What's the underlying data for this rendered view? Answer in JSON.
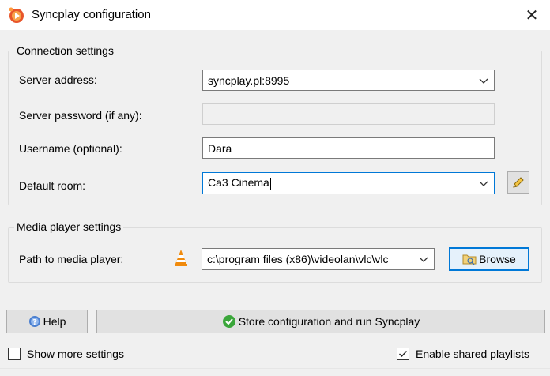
{
  "window": {
    "title": "Syncplay configuration",
    "icon": "syncplay-logo-icon",
    "close_label": "✕"
  },
  "connection": {
    "group_title": "Connection settings",
    "server_address_label": "Server address:",
    "server_address_value": "syncplay.pl:8995",
    "server_password_label": "Server password (if any):",
    "server_password_value": "",
    "username_label": "Username (optional):",
    "username_value": "Dara",
    "default_room_label": "Default room:",
    "default_room_value": "Ca3 Cinema",
    "edit_room_icon": "pencil-icon"
  },
  "media": {
    "group_title": "Media player settings",
    "path_label": "Path to media player:",
    "player_icon": "vlc-icon",
    "path_value": "c:\\program files (x86)\\videolan\\vlc\\vlc",
    "browse_label": "Browse",
    "browse_icon": "folder-icon"
  },
  "footer": {
    "help_label": "Help",
    "help_icon": "help-icon",
    "run_label": "Store configuration and run Syncplay",
    "run_icon": "checkmark-icon",
    "show_more_label": "Show more settings",
    "show_more_checked": false,
    "shared_playlists_label": "Enable shared playlists",
    "shared_playlists_checked": true
  },
  "colors": {
    "accent": "#0078d7",
    "window_bg": "#f0f0f0",
    "brand": "#e8552a"
  }
}
